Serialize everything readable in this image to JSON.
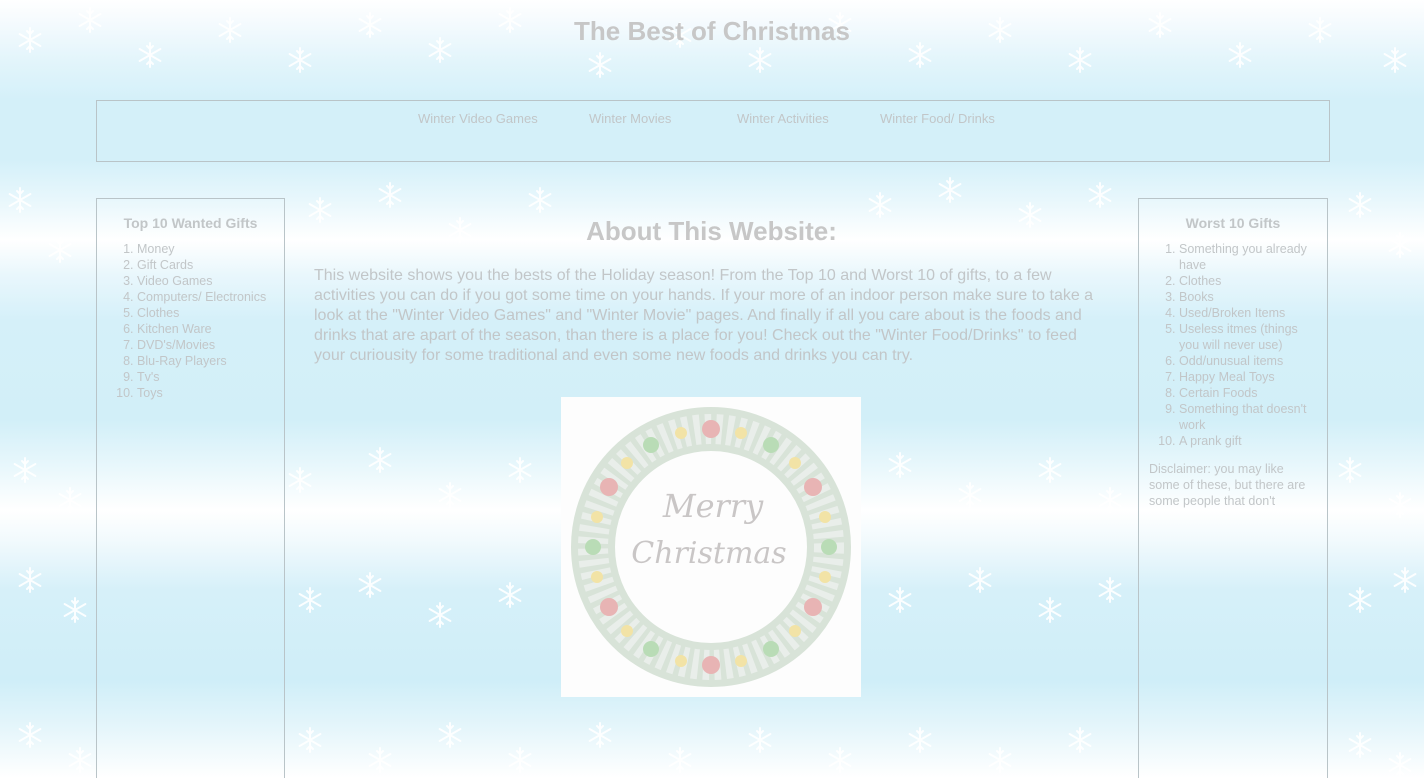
{
  "header": {
    "title": "The Best of Christmas"
  },
  "nav": {
    "items": [
      {
        "label": "Winter Video Games"
      },
      {
        "label": "Winter Movies"
      },
      {
        "label": "Winter Activities"
      },
      {
        "label": "Winter Food/ Drinks"
      }
    ]
  },
  "left_sidebar": {
    "heading": "Top 10 Wanted Gifts",
    "items": [
      "Money",
      "Gift Cards",
      "Video Games",
      "Computers/ Electronics",
      "Clothes",
      "Kitchen Ware",
      "DVD's/Movies",
      "Blu-Ray Players",
      "Tv's",
      "Toys"
    ]
  },
  "right_sidebar": {
    "heading": "Worst 10 Gifts",
    "items": [
      "Something you already have",
      "Clothes",
      "Books",
      "Used/Broken Items",
      "Useless itmes (things you will never use)",
      "Odd/unusual items",
      "Happy Meal Toys",
      "Certain Foods",
      "Something that doesn't work",
      "A prank gift"
    ],
    "disclaimer": "Disclaimer: you may like some of these, but there are some people that don't"
  },
  "main": {
    "heading": "About This Website:",
    "paragraph": "This website shows you the bests of the Holiday season! From the Top 10 and Worst 10 of gifts, to a few activities you can do if you got some time on your hands. If your more of an indoor person make sure to take a look at the \"Winter Video Games\" and \"Winter Movie\" pages. And finally if all you care about is the foods and drinks that are apart of the season, than there is a place for you! Check out the \"Winter Food/Drinks\" to feed your curiousity for some traditional and even some new foods and drinks you can try.",
    "image": {
      "text_line1": "Merry",
      "text_line2": "Christmas"
    }
  },
  "colors": {
    "background": "#cfeef8",
    "text": "#c2c6c8",
    "border": "#b9c4c8"
  },
  "icons": {
    "decoration": "snowflake-icon"
  }
}
